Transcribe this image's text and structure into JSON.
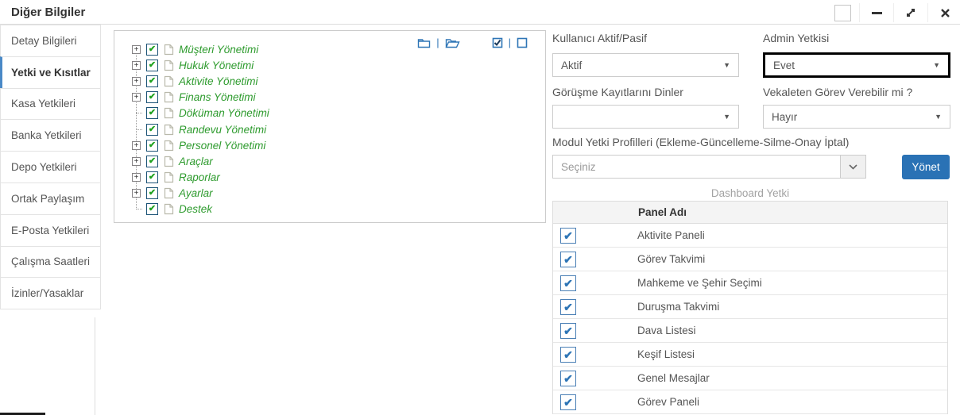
{
  "window": {
    "title": "Diğer Bilgiler",
    "controls": {
      "restore": "restore",
      "minimize": "minimize",
      "maximize": "maximize",
      "close": "close"
    }
  },
  "sidebar": {
    "tabs": [
      {
        "label": "Detay Bilgileri",
        "active": false
      },
      {
        "label": "Yetki ve Kısıtlar",
        "active": true
      },
      {
        "label": "Kasa Yetkileri",
        "active": false
      },
      {
        "label": "Banka Yetkileri",
        "active": false
      },
      {
        "label": "Depo Yetkileri",
        "active": false
      },
      {
        "label": "Ortak Paylaşım",
        "active": false
      },
      {
        "label": "E-Posta Yetkileri",
        "active": false
      },
      {
        "label": "Çalışma Saatleri",
        "active": false
      },
      {
        "label": "İzinler/Yasaklar",
        "active": false
      }
    ]
  },
  "tree": {
    "toolbar": {
      "collapse_all": "folder-closed",
      "expand_all": "folder-open",
      "check_all": "checkbox-checked",
      "uncheck_all": "checkbox-unchecked"
    },
    "check_glyph": "✔",
    "expand_glyph": "+",
    "items": [
      {
        "label": "Müşteri Yönetimi",
        "expandable": true,
        "checked": true
      },
      {
        "label": "Hukuk Yönetimi",
        "expandable": true,
        "checked": true
      },
      {
        "label": "Aktivite Yönetimi",
        "expandable": true,
        "checked": true
      },
      {
        "label": "Finans Yönetimi",
        "expandable": true,
        "checked": true
      },
      {
        "label": "Döküman Yönetimi",
        "expandable": false,
        "checked": true
      },
      {
        "label": "Randevu Yönetimi",
        "expandable": false,
        "checked": true
      },
      {
        "label": "Personel Yönetimi",
        "expandable": true,
        "checked": true
      },
      {
        "label": "Araçlar",
        "expandable": true,
        "checked": true
      },
      {
        "label": "Raporlar",
        "expandable": true,
        "checked": true
      },
      {
        "label": "Ayarlar",
        "expandable": true,
        "checked": true
      },
      {
        "label": "Destek",
        "expandable": false,
        "checked": true
      }
    ]
  },
  "form": {
    "kullanici_aktif": {
      "label": "Kullanıcı Aktif/Pasif",
      "value": "Aktif"
    },
    "admin_yetkisi": {
      "label": "Admin Yetkisi",
      "value": "Evet",
      "focused": true
    },
    "gorusme": {
      "label": "Görüşme Kayıtlarını Dinler",
      "value": ""
    },
    "vekaleten": {
      "label": "Vekaleten Görev Verebilir mi ?",
      "value": "Hayır"
    },
    "modul": {
      "label": "Modul Yetki Profilleri (Ekleme-Güncelleme-Silme-Onay İptal)",
      "placeholder": "Seçiniz",
      "button_label": "Yönet"
    }
  },
  "dashboard": {
    "title": "Dashboard Yetki",
    "column_header": "Panel Adı",
    "check_glyph": "✔",
    "rows": [
      {
        "label": "Aktivite Paneli",
        "checked": true
      },
      {
        "label": "Görev Takvimi",
        "checked": true
      },
      {
        "label": "Mahkeme ve Şehir Seçimi",
        "checked": true
      },
      {
        "label": "Duruşma Takvimi",
        "checked": true
      },
      {
        "label": "Dava Listesi",
        "checked": true
      },
      {
        "label": "Keşif Listesi",
        "checked": true
      },
      {
        "label": "Genel Mesajlar",
        "checked": true
      },
      {
        "label": "Görev Paneli",
        "checked": true
      }
    ]
  },
  "colors": {
    "toolbar_icon_blue": "#2e75b6",
    "button_blue": "#2a72b5",
    "tree_text_green": "#2e9b2e",
    "tree_check_green": "#1ea11e",
    "active_tab_accent": "#4a89c7",
    "focused_select_border": "#000000"
  }
}
